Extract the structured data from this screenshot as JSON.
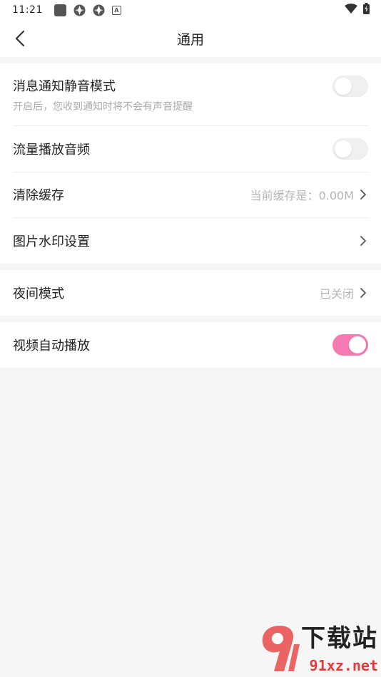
{
  "status_bar": {
    "time": "11:21"
  },
  "nav": {
    "title": "通用"
  },
  "group1": {
    "silent_title": "消息通知静音模式",
    "silent_sub": "开启后，您收到通知时将不会有声音提醒",
    "silent_on": false,
    "data_audio_title": "流量播放音频",
    "data_audio_on": false,
    "clear_cache_title": "清除缓存",
    "clear_cache_value": "当前缓存是：0.00M",
    "watermark_title": "图片水印设置"
  },
  "group2": {
    "night_title": "夜间模式",
    "night_value": "已关闭"
  },
  "group3": {
    "autoplay_title": "视频自动播放",
    "autoplay_on": true
  },
  "watermark": {
    "text": "下载站",
    "url": "91xz.net"
  },
  "colors": {
    "accent": "#f57ab2",
    "background": "#f6f6f6"
  }
}
